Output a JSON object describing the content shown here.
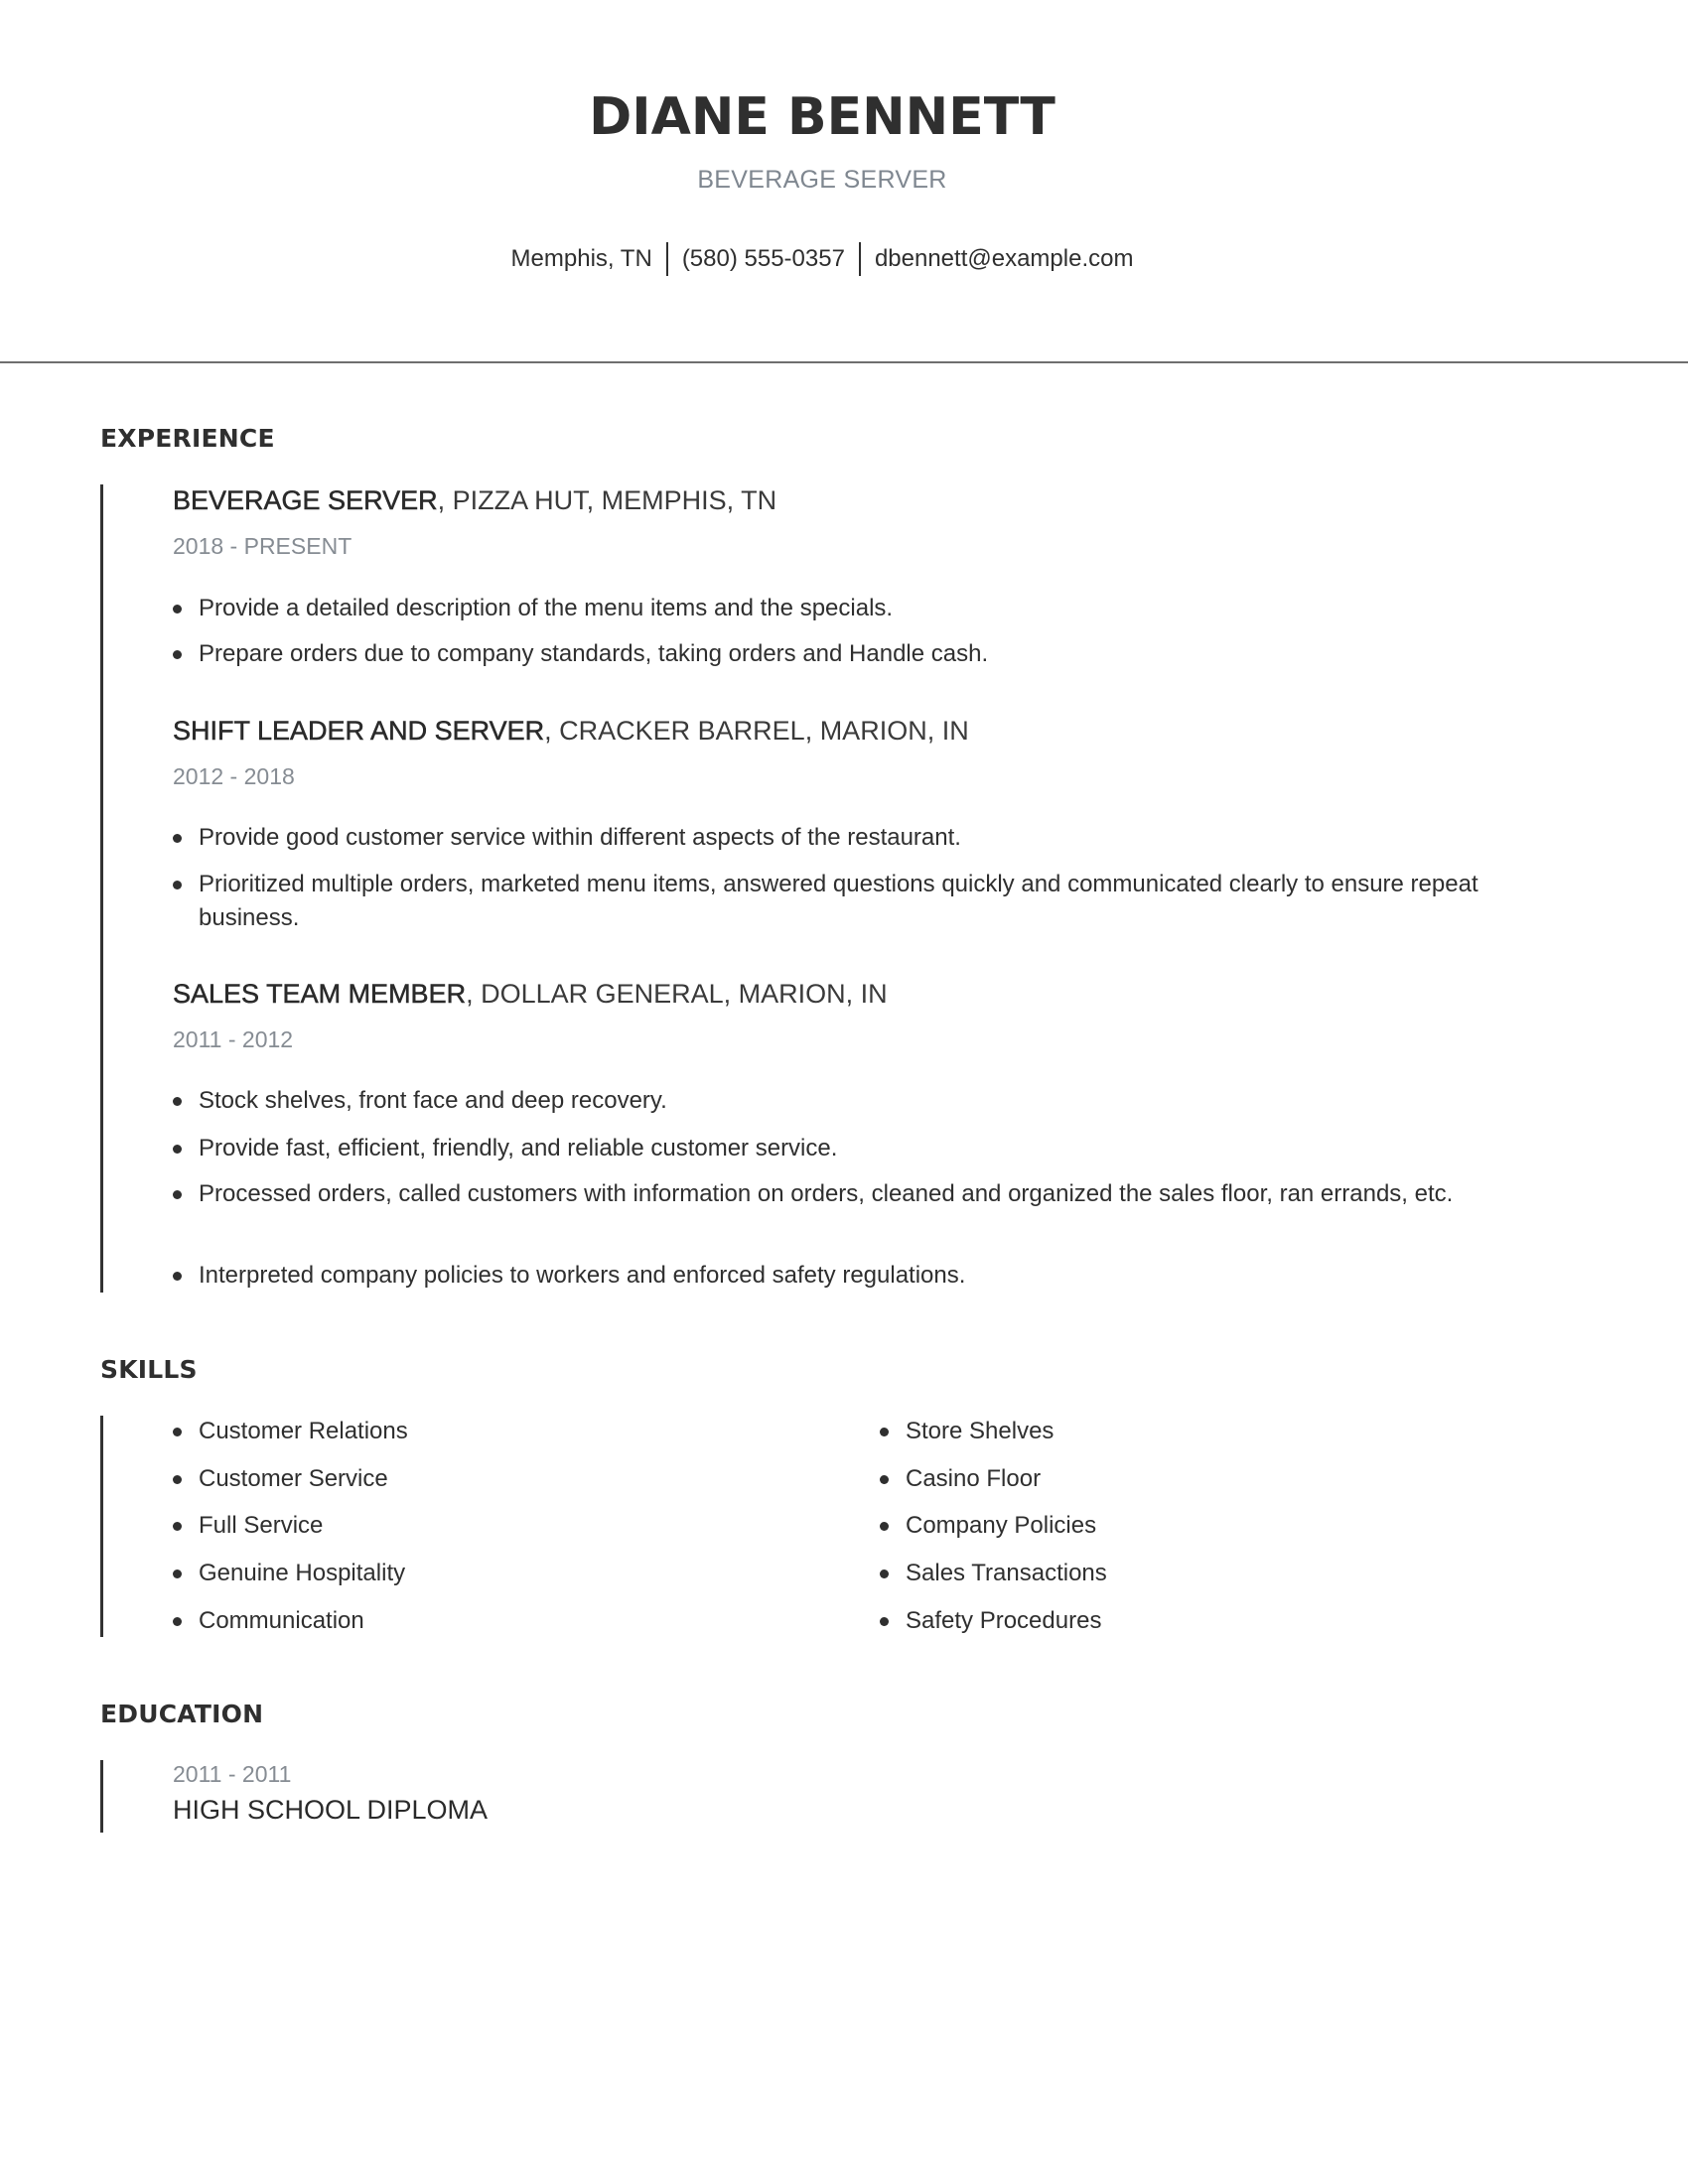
{
  "header": {
    "name": "DIANE BENNETT",
    "title": "BEVERAGE SERVER",
    "contact": {
      "location": "Memphis, TN",
      "phone": "(580) 555-0357",
      "email": "dbennett@example.com"
    }
  },
  "experience": {
    "heading": "EXPERIENCE",
    "jobs": [
      {
        "role": "BEVERAGE SERVER",
        "employer": ", PIZZA HUT, MEMPHIS, TN",
        "dates": "2018 - PRESENT",
        "bullets": [
          "Provide a detailed description of the menu items and the specials.",
          "Prepare orders due to company standards, taking orders and Handle cash."
        ]
      },
      {
        "role": "SHIFT LEADER AND SERVER",
        "employer": ", CRACKER BARREL, MARION, IN",
        "dates": "2012 - 2018",
        "bullets": [
          "Provide good customer service within different aspects of the restaurant.",
          "Prioritized multiple orders, marketed menu items, answered questions quickly and communicated clearly to ensure repeat business."
        ]
      },
      {
        "role": "SALES TEAM MEMBER",
        "employer": ", DOLLAR GENERAL, MARION, IN",
        "dates": "2011 - 2012",
        "bullets": [
          "Stock shelves, front face and deep recovery.",
          "Provide fast, efficient, friendly, and reliable customer service.",
          "Processed orders, called customers with information on orders, cleaned and organized the sales floor, ran errands, etc.",
          "Interpreted company policies to workers and enforced safety regulations."
        ]
      }
    ]
  },
  "skills": {
    "heading": "SKILLS",
    "left": [
      "Customer Relations",
      "Customer Service",
      "Full Service",
      "Genuine Hospitality",
      "Communication"
    ],
    "right": [
      "Store Shelves",
      "Casino Floor",
      "Company Policies",
      "Sales Transactions",
      "Safety Procedures"
    ]
  },
  "education": {
    "heading": "EDUCATION",
    "dates": "2011 - 2011",
    "degree": "HIGH SCHOOL DIPLOMA"
  }
}
